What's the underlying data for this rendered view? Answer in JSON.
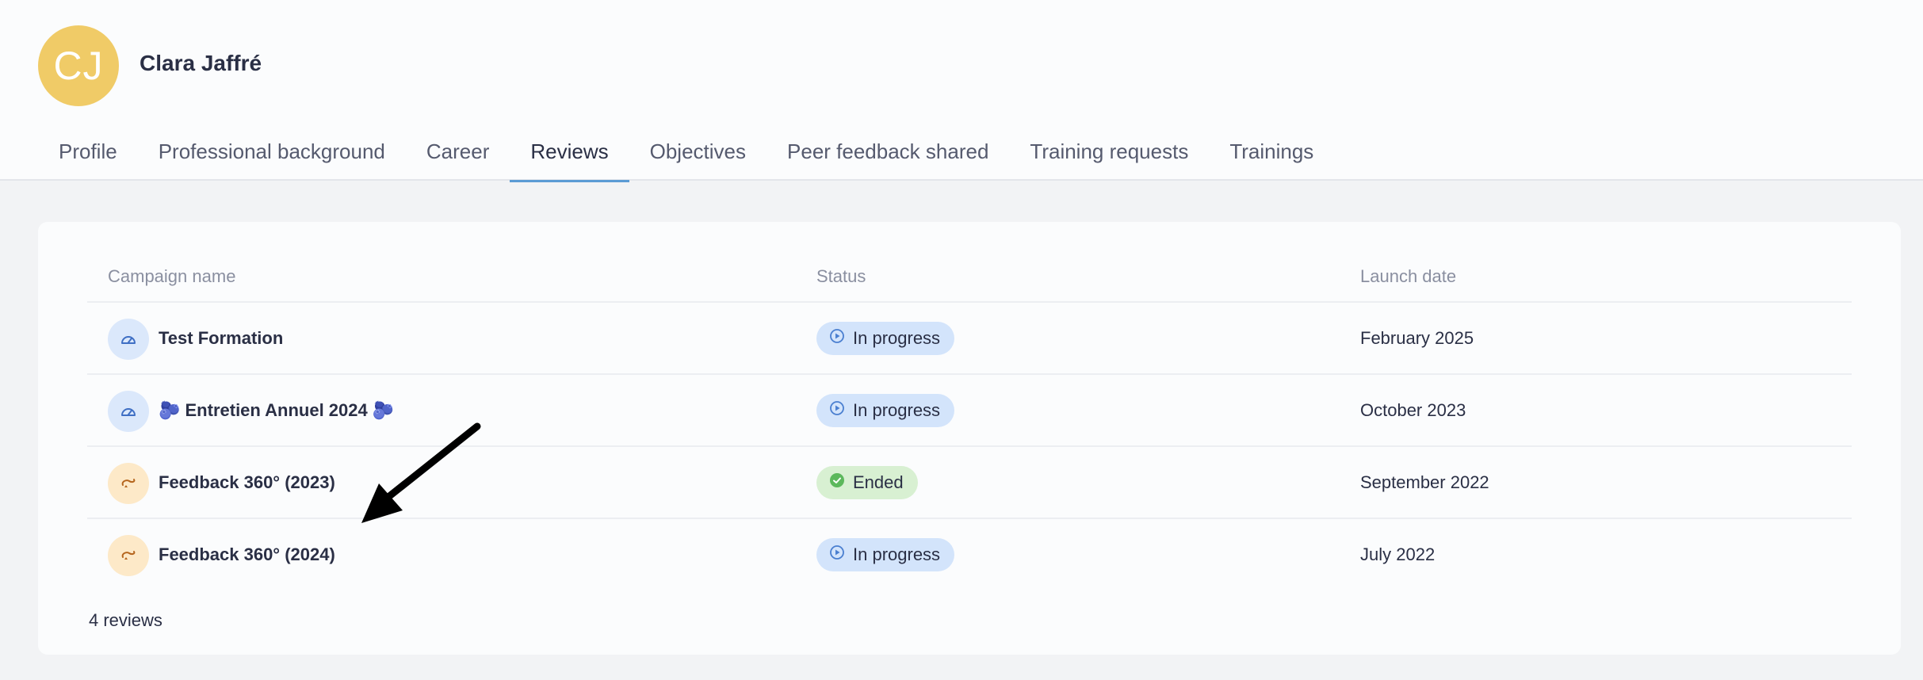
{
  "user": {
    "initials": "CJ",
    "name": "Clara Jaffré",
    "avatar_color": "#f0cb67"
  },
  "tabs": [
    {
      "label": "Profile",
      "active": false
    },
    {
      "label": "Professional background",
      "active": false
    },
    {
      "label": "Career",
      "active": false
    },
    {
      "label": "Reviews",
      "active": true
    },
    {
      "label": "Objectives",
      "active": false
    },
    {
      "label": "Peer feedback shared",
      "active": false
    },
    {
      "label": "Training requests",
      "active": false
    },
    {
      "label": "Trainings",
      "active": false
    }
  ],
  "table": {
    "columns": [
      "Campaign name",
      "Status",
      "Launch date"
    ],
    "rows": [
      {
        "icon": "gauge-icon",
        "icon_color": "blue",
        "name": "Test Formation",
        "status": "In progress",
        "status_type": "progress",
        "launch": "February 2025"
      },
      {
        "icon": "gauge-icon",
        "icon_color": "blue",
        "name": "🫐 Entretien Annuel 2024 🫐",
        "status": "In progress",
        "status_type": "progress",
        "launch": "October 2023"
      },
      {
        "icon": "feedback-loop-icon",
        "icon_color": "orange",
        "name": "Feedback 360° (2023)",
        "status": "Ended",
        "status_type": "ended",
        "launch": "September 2022"
      },
      {
        "icon": "feedback-loop-icon",
        "icon_color": "orange",
        "name": "Feedback 360° (2024)",
        "status": "In progress",
        "status_type": "progress",
        "launch": "July 2022"
      }
    ],
    "count_label": "4 reviews"
  },
  "colors": {
    "accent": "#5b9bd5",
    "progress_bg": "#d3e4fb",
    "ended_bg": "#d8f0d2",
    "ended_check": "#5cb85c"
  }
}
